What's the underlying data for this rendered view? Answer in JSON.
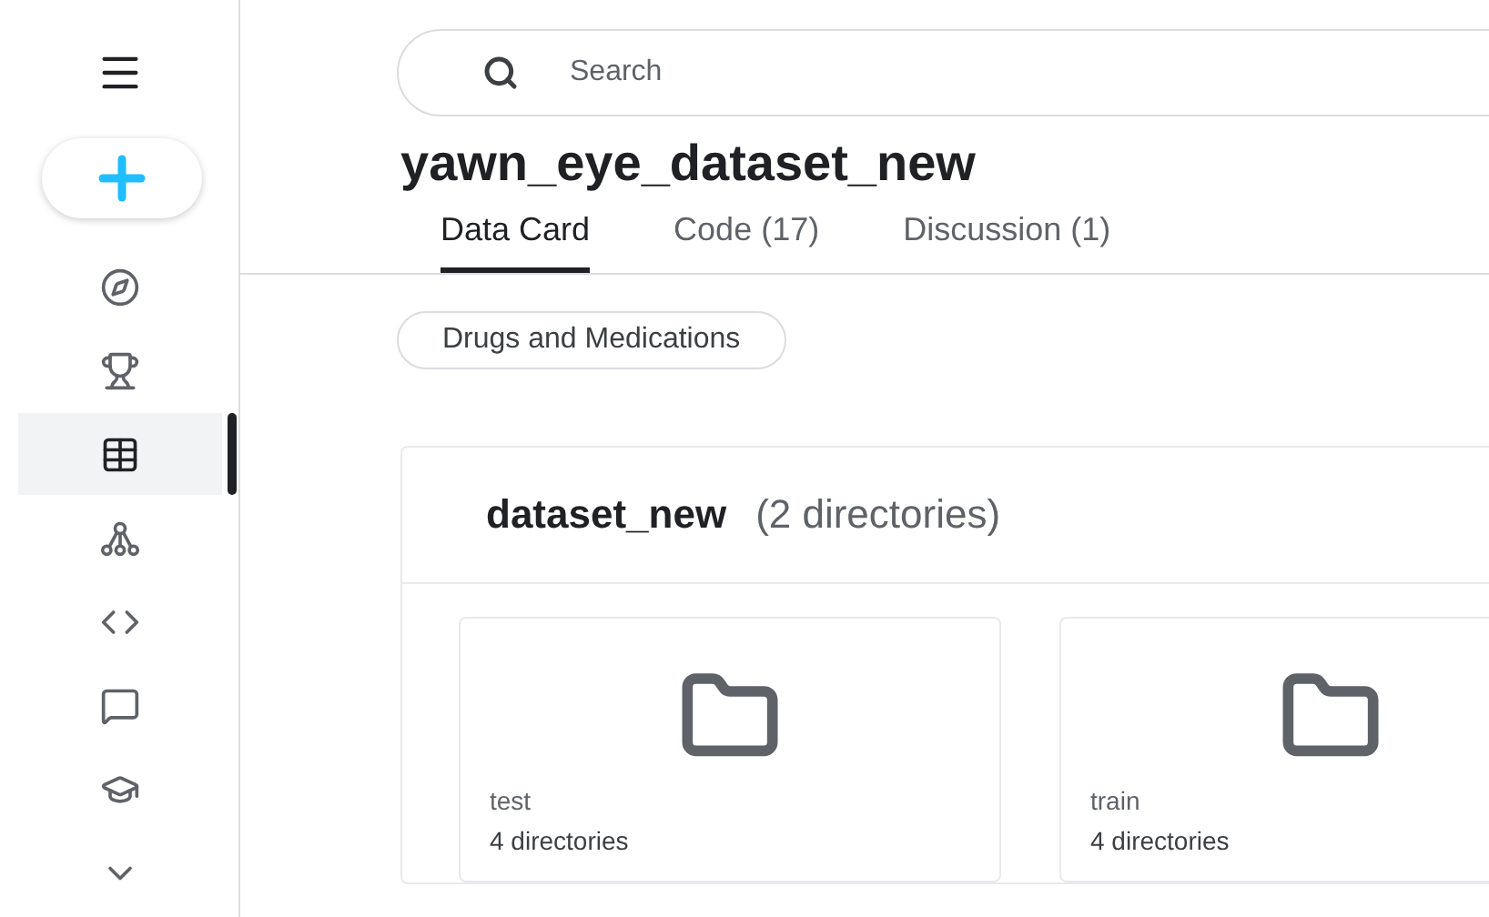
{
  "sidebar": {
    "items": [
      {
        "kind": "compass",
        "selected": false
      },
      {
        "kind": "trophy",
        "selected": false
      },
      {
        "kind": "table",
        "selected": true
      },
      {
        "kind": "network",
        "selected": false
      },
      {
        "kind": "code",
        "selected": false
      },
      {
        "kind": "comment",
        "selected": false
      },
      {
        "kind": "school",
        "selected": false
      },
      {
        "kind": "more",
        "selected": false
      }
    ]
  },
  "search": {
    "placeholder": "Search"
  },
  "title": "yawn_eye_dataset_new",
  "tabs": [
    {
      "label": "Data Card",
      "selected": true
    },
    {
      "label": "Code (17)",
      "selected": false
    },
    {
      "label": "Discussion (1)",
      "selected": false
    }
  ],
  "tags": [
    "Drugs and Medications"
  ],
  "explorer": {
    "name": "dataset_new",
    "count": "(2 directories)",
    "folders": [
      {
        "name": "test",
        "count": "4 directories"
      },
      {
        "name": "train",
        "count": "4 directories"
      }
    ]
  }
}
